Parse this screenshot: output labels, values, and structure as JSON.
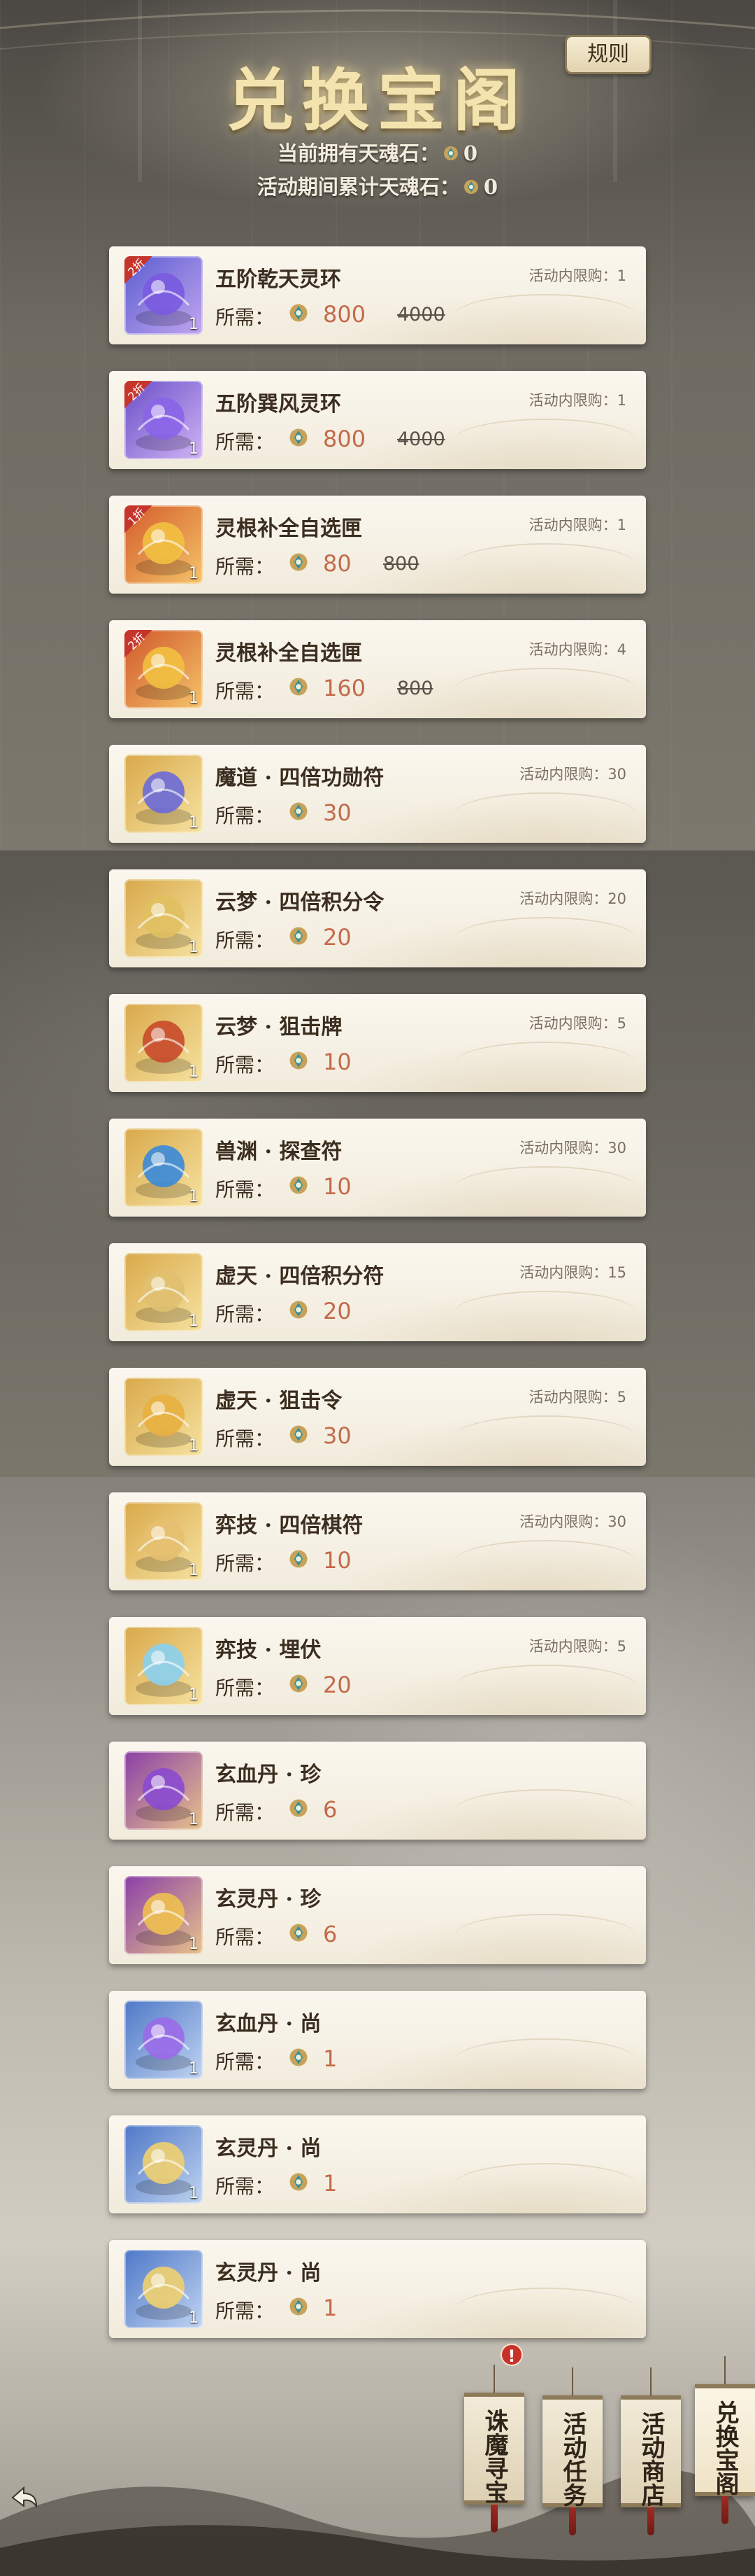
{
  "header": {
    "title": "兑换宝阁",
    "rules_label": "规则",
    "owned_label": "当前拥有天魂石：",
    "owned_value": "0",
    "total_label": "活动期间累计天魂石：",
    "total_value": "0"
  },
  "items": [
    {
      "name": "五阶乾天灵环",
      "limit": "活动内限购：1",
      "req": "所需：",
      "price": "800",
      "orig": "4000",
      "badge": "2折",
      "qty": "1"
    },
    {
      "name": "五阶巽风灵环",
      "limit": "活动内限购：1",
      "req": "所需：",
      "price": "800",
      "orig": "4000",
      "badge": "2折",
      "qty": "1"
    },
    {
      "name": "灵根补全自选匣",
      "limit": "活动内限购：1",
      "req": "所需：",
      "price": "80",
      "orig": "800",
      "badge": "1折",
      "qty": "1"
    },
    {
      "name": "灵根补全自选匣",
      "limit": "活动内限购：4",
      "req": "所需：",
      "price": "160",
      "orig": "800",
      "badge": "2折",
      "qty": "1"
    },
    {
      "name": "魔道 · 四倍功勋符",
      "limit": "活动内限购：30",
      "req": "所需：",
      "price": "30",
      "qty": "1"
    },
    {
      "name": "云梦 · 四倍积分令",
      "limit": "活动内限购：20",
      "req": "所需：",
      "price": "20",
      "qty": "1"
    },
    {
      "name": "云梦 · 狙击牌",
      "limit": "活动内限购：5",
      "req": "所需：",
      "price": "10",
      "qty": "1"
    },
    {
      "name": "兽渊 · 探查符",
      "limit": "活动内限购：30",
      "req": "所需：",
      "price": "10",
      "qty": "1"
    },
    {
      "name": "虚天 · 四倍积分符",
      "limit": "活动内限购：15",
      "req": "所需：",
      "price": "20",
      "qty": "1"
    },
    {
      "name": "虚天 · 狙击令",
      "limit": "活动内限购：5",
      "req": "所需：",
      "price": "30",
      "qty": "1"
    },
    {
      "name": "弈技 · 四倍棋符",
      "limit": "活动内限购：30",
      "req": "所需：",
      "price": "10",
      "qty": "1"
    },
    {
      "name": "弈技 · 埋伏",
      "limit": "活动内限购：5",
      "req": "所需：",
      "price": "20",
      "qty": "1"
    },
    {
      "name": "玄血丹 · 珍",
      "req": "所需：",
      "price": "6",
      "qty": "1"
    },
    {
      "name": "玄灵丹 · 珍",
      "req": "所需：",
      "price": "6",
      "qty": "1"
    },
    {
      "name": "玄血丹 · 尚",
      "req": "所需：",
      "price": "1",
      "qty": "1"
    },
    {
      "name": "玄灵丹 · 尚",
      "req": "所需：",
      "price": "1",
      "qty": "1"
    },
    {
      "name": "玄灵丹 · 尚",
      "req": "所需：",
      "price": "1",
      "qty": "1"
    }
  ],
  "nav": {
    "tab1": "诛魔寻宝",
    "tab2": "活动任务",
    "tab3": "活动商店",
    "tab4": "兑换宝阁",
    "alert": "!"
  },
  "colors": {
    "price": "#c46a4c",
    "title_gold": "#f3e3ae",
    "card_bg": "#f7f2e6",
    "badge_red": "#c6352b"
  }
}
